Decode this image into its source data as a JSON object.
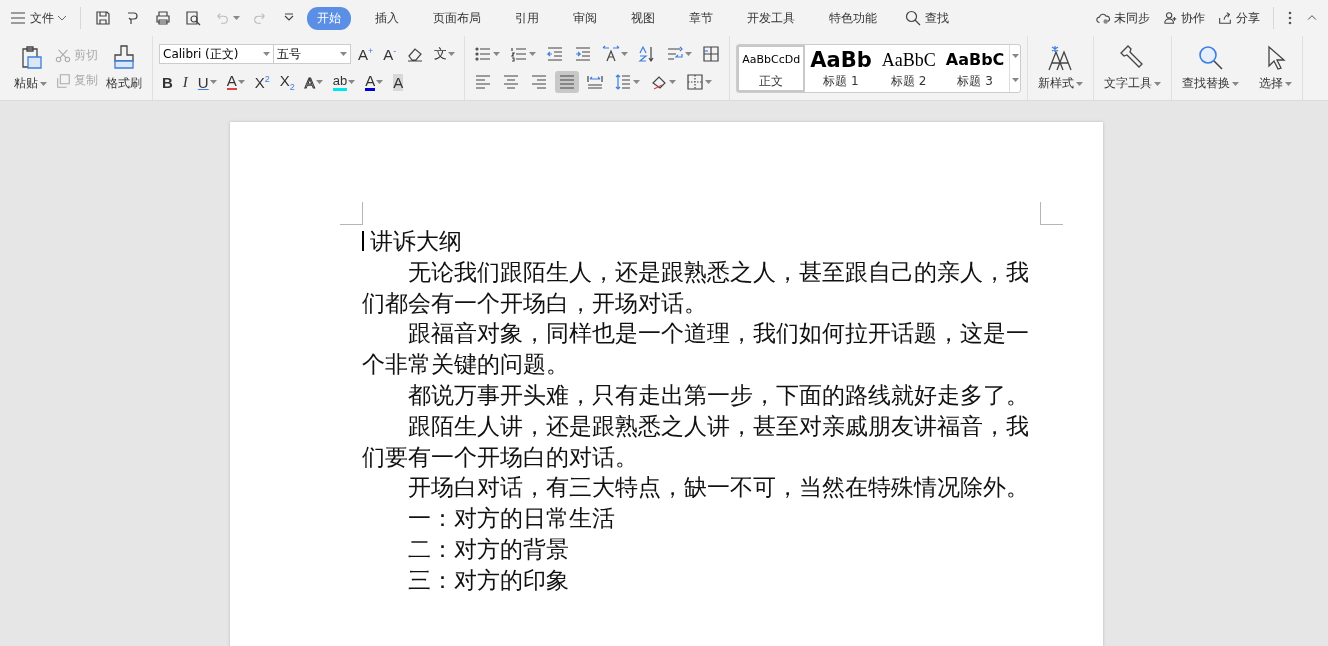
{
  "menu_bar": {
    "file_menu": "文件",
    "tabs": [
      {
        "label": "开始",
        "selected": true
      },
      {
        "label": "插入",
        "selected": false
      },
      {
        "label": "页面布局",
        "selected": false
      },
      {
        "label": "引用",
        "selected": false
      },
      {
        "label": "审阅",
        "selected": false
      },
      {
        "label": "视图",
        "selected": false
      },
      {
        "label": "章节",
        "selected": false
      },
      {
        "label": "开发工具",
        "selected": false
      },
      {
        "label": "特色功能",
        "selected": false
      }
    ],
    "search": "查找",
    "actions": [
      {
        "kind": "cloud",
        "label": "未同步"
      },
      {
        "kind": "person",
        "label": "协作"
      },
      {
        "kind": "share",
        "label": "分享"
      }
    ]
  },
  "clipboard": {
    "paste": "粘贴",
    "cut": {
      "label": "剪切",
      "disabled": true
    },
    "copy": {
      "label": "复制",
      "disabled": true
    },
    "format_painter": "格式刷"
  },
  "font": {
    "font_name": "Calibri (正文)",
    "font_size": "五号",
    "row1": [
      {
        "kind": "grow",
        "glyph": "A$^{+}$"
      },
      {
        "kind": "shrink",
        "glyph": "A$^{-}$"
      },
      {
        "kind": "eraser"
      },
      {
        "kind": "pinyin",
        "glyph": "文"
      }
    ],
    "row2": [
      {
        "kind": "bold",
        "glyph": "B"
      },
      {
        "kind": "italic",
        "glyph": "I"
      },
      {
        "kind": "underline",
        "glyph": "U"
      },
      {
        "kind": "strike",
        "glyph": "A"
      },
      {
        "kind": "sup",
        "glyph": "X$^{2}$"
      },
      {
        "kind": "sub",
        "glyph": "X$_{2}$"
      },
      {
        "kind": "outline",
        "glyph": "A"
      },
      {
        "kind": "highlight",
        "glyph": "ab"
      },
      {
        "kind": "color",
        "glyph": "A"
      },
      {
        "kind": "shade",
        "glyph": "A"
      }
    ]
  },
  "paragraph": {
    "row1": [
      {
        "kind": "bullets"
      },
      {
        "kind": "numbering"
      },
      {
        "kind": "outdent"
      },
      {
        "kind": "indent"
      },
      {
        "kind": "direction"
      },
      {
        "kind": "sort"
      },
      {
        "kind": "lines"
      },
      {
        "kind": "table"
      }
    ],
    "row2": [
      {
        "kind": "left",
        "selected": false
      },
      {
        "kind": "center",
        "selected": false
      },
      {
        "kind": "right",
        "selected": false
      },
      {
        "kind": "justify",
        "selected": true
      },
      {
        "kind": "distribute",
        "selected": false
      },
      {
        "kind": "spacing",
        "selected": false
      },
      {
        "kind": "fill",
        "selected": false
      },
      {
        "kind": "border",
        "selected": false
      }
    ]
  },
  "styles": [
    {
      "kind": "normal",
      "preview": "AaBbCcDd",
      "label": "正文",
      "selected": true
    },
    {
      "kind": "h1",
      "preview": "AaBb",
      "label": "标题 1",
      "selected": false
    },
    {
      "kind": "h2",
      "preview": "AaBbC",
      "label": "标题 2",
      "selected": false
    },
    {
      "kind": "h3",
      "preview": "AaBbC",
      "label": "标题 3",
      "selected": false
    }
  ],
  "tools": [
    {
      "kind": "newstyle",
      "label": "新样式"
    },
    {
      "kind": "wrench",
      "label": "文字工具"
    },
    {
      "kind": "find",
      "label": "查找替换"
    },
    {
      "kind": "pointer",
      "label": "选择"
    }
  ],
  "document": {
    "title": "讲诉大纲",
    "paragraphs": [
      "无论我们跟陌生人，还是跟熟悉之人，甚至跟自己的亲人，我们都会有一个开场白，开场对话。",
      "跟福音对象，同样也是一个道理，我们如何拉开话题，这是一个非常关键的问题。",
      "都说万事开头难，只有走出第一步，下面的路线就好走多了。",
      "跟陌生人讲，还是跟熟悉之人讲，甚至对亲戚朋友讲福音，我们要有一个开场白的对话。",
      "开场白对话，有三大特点，缺一不可，当然在特殊情况除外。",
      "一：对方的日常生活",
      "二：对方的背景",
      "三：对方的印象"
    ]
  }
}
